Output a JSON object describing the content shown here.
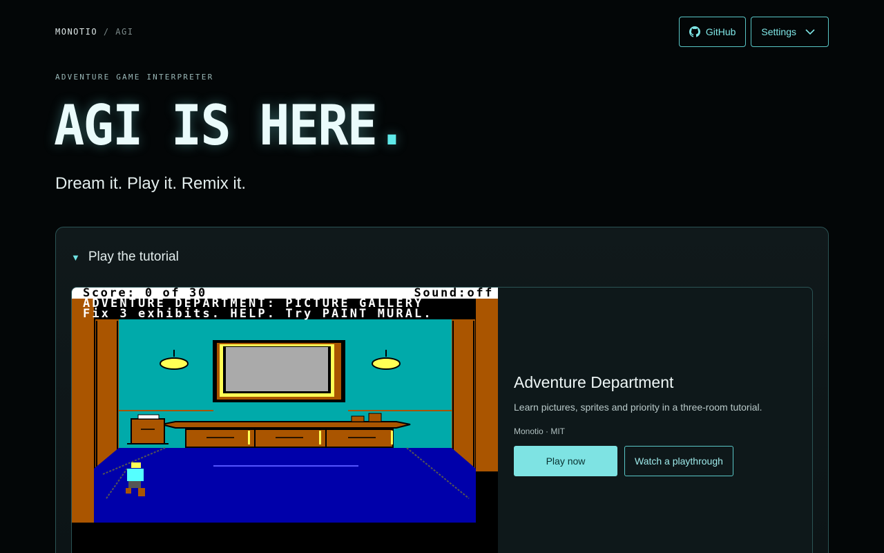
{
  "brand": {
    "name": "MONOTIO",
    "separator": "/",
    "section": "AGI"
  },
  "header": {
    "github_label": "GitHub",
    "settings_label": "Settings"
  },
  "hero": {
    "eyebrow": "ADVENTURE GAME INTERPRETER",
    "title": "AGI IS HERE",
    "title_dot": ".",
    "tagline": "Dream it. Play it. Remix it."
  },
  "tutorial": {
    "summary_label": "Play the tutorial",
    "expanded": true,
    "game": {
      "status_left": "Score: 0 of 30",
      "status_right": "Sound:off",
      "message_line1": "ADVENTURE DEPARTMENT: PICTURE GALLERY",
      "message_line2": "Fix 3 exhibits. HELP. Try PAINT MURAL."
    },
    "card": {
      "title": "Adventure Department",
      "description": "Learn pictures, sprites and priority in a three-room tutorial.",
      "meta": "Monotio · MIT",
      "play_label": "Play now",
      "watch_label": "Watch a playthrough"
    }
  },
  "colors": {
    "accent": "#7ee3e3",
    "background": "#030607",
    "panel_border": "#2b5455"
  },
  "icons": {
    "github": "github-icon",
    "settings": "chevron-down-icon",
    "summary": "disclosure-triangle-icon"
  }
}
